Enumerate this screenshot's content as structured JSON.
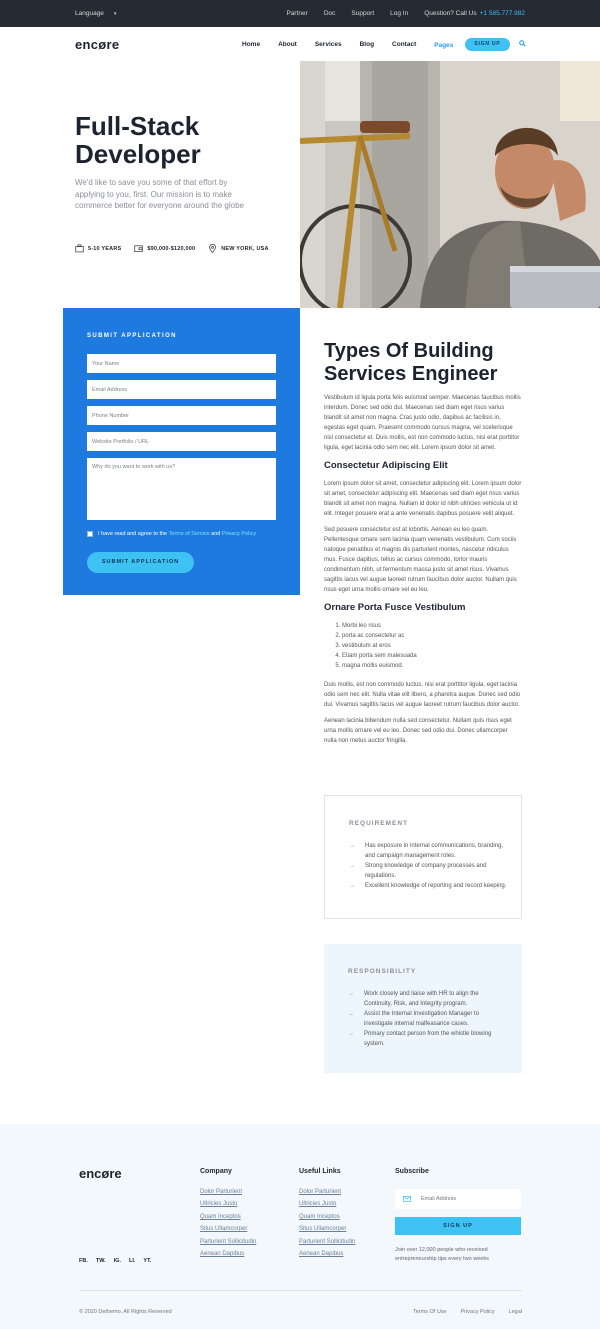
{
  "topbar": {
    "language": "Language",
    "links": [
      "Partner",
      "Doc",
      "Support",
      "Log In"
    ],
    "question": "Question? Call Us",
    "phone": "+1 585.777.982"
  },
  "nav": {
    "logo": "encøre",
    "items": [
      "Home",
      "About",
      "Services",
      "Blog",
      "Contact"
    ],
    "active_item": "Pages",
    "signup": "SIGN UP"
  },
  "hero": {
    "title_line1": "Full-Stack",
    "title_line2": "Developer",
    "description": "We'd like to save you some of that effort by applying to you, first. Our mission is to make commerce better for everyone around the globe",
    "experience": "5-10 YEARS",
    "salary": "$90,000-$120,000",
    "location": "NEW YORK, USA"
  },
  "application": {
    "title": "SUBMIT APPLICATION",
    "name_placeholder": "Your Name",
    "email_placeholder": "Email Address",
    "phone_placeholder": "Phone Number",
    "website_placeholder": "Website Portfolio / URL",
    "message_placeholder": "Why do you want to work with us?",
    "agree_prefix": "I have read and agree to the",
    "terms_link": "Terms of Service",
    "agree_and": "and",
    "privacy_link": "Privacy Policy",
    "submit": "SUBMIT APPLICATION"
  },
  "article": {
    "title": "Types Of Building Services Engineer",
    "p1": "Vestibulum id ligula porta felis euismod semper. Maecenas faucibus mollis interdum. Donec sed odio dui. Maecenas sed diam eget risus varius blandit sit amet non magna. Cras justo odio, dapibus ac facilisis in, egestas eget quam. Praesent commodo cursus magna, vel scelerisque nisl consectetur et. Duis mollis, est non commodo luctus, nisi erat porttitor ligula, eget lacinia odio sem nec elit. Lorem ipsum dolor sit amet.",
    "h2": "Consectetur Adipiscing Elit",
    "p2": "Lorem ipsum dolor sit amet, consectetur adipiscing elit. Lorem ipsum dolor sit amet, consectetur adipiscing elit. Maecenas sed diam eget risus varius blandit sit amet non magna. Nullam id dolor id nibh ultricies vehicula ut id elit. Integer posuere erat a ante venenatis dapibus posuere velit aliquet.",
    "p3": "Sed posuere consectetur est at lobortis. Aenean eu leo quam. Pellentesque ornare sem lacinia quam venenatis vestibulum. Cum sociis natoque penatibus et magnis dis parturient montes, nascetur ridiculus mus. Fusce dapibus, tellus ac cursus commodo, tortor mauris condimentum nibh, ut fermentum massa justo sit amet risus. Vivamus sagittis lacus vel augue laoreet rutrum faucibus dolor auctor. Nullam quis risus eget urna mollis ornare vel eu leo.",
    "h3": "Ornare Porta Fusce Vestibulum",
    "list": [
      "Morbi leo risus",
      "porta ac consectetur ac",
      "vestibulum at eros",
      "Etiam porta sem malesuada",
      "magna mollis euismod."
    ],
    "p4": "Duis mollis, est non commodo luctus, nisi erat porttitor ligula, eget lacinia odio sem nec elit. Nulla vitae elit libero, a pharetra augue. Donec sed odio dui. Vivamus sagittis lacus vel augue laoreet rutrum faucibus dolor auctor.",
    "p5": "Aenean lacinia bibendum nulla sed consectetur. Nullam quis risus eget urna mollis ornare vel eu leo. Donec sed odio dui. Donec ullamcorper nulla non metus auctor fringilla."
  },
  "requirement": {
    "title": "REQUIREMENT",
    "items": [
      "Has exposure in internal communications, branding, and campaign management roles.",
      "Strong knowledge of company processes and regulations.",
      "Excellent knowledge of reporting and record keeping."
    ]
  },
  "responsibility": {
    "title": "RESPONSIBILITY",
    "items": [
      "Work closely and liaise with HR to align the Continuity, Risk, and Integrity program.",
      "Assist the Internal Investigation Manager to investigate internal malfeasance cases.",
      "Primary contact person from the whistle blowing system."
    ]
  },
  "footer": {
    "logo": "encøre",
    "social": [
      "FB.",
      "TW.",
      "IG.",
      "LI.",
      "YT."
    ],
    "company_title": "Company",
    "company_links": [
      "Dolor Parturient",
      "Ultricies Justo",
      "Quam Inceptos",
      "Situs Ullamcorper",
      "Parturient Sollicitudin",
      "Aenean Dapibus"
    ],
    "useful_title": "Useful Links",
    "useful_links": [
      "Dolor Parturient",
      "Ultricies Justo",
      "Quam Inceptos",
      "Situs Ullamcorper",
      "Parturient Sollicitudin",
      "Aenean Dapibus"
    ],
    "subscribe_title": "Subscribe",
    "email_placeholder": "Email Address",
    "signup": "SIGN UP",
    "note": "Join over 12,000 people who received entrepreneurship tips every two weeks",
    "copyright": "© 2020 Dethemo. All Rights Reserved",
    "legal": [
      "Terms Of Use",
      "Privacy Policy",
      "Legal"
    ]
  },
  "colors": {
    "accent": "#3ec1f3",
    "form_blue": "#1f7ae0",
    "topbar": "#262b33",
    "heading": "#1d2430"
  }
}
